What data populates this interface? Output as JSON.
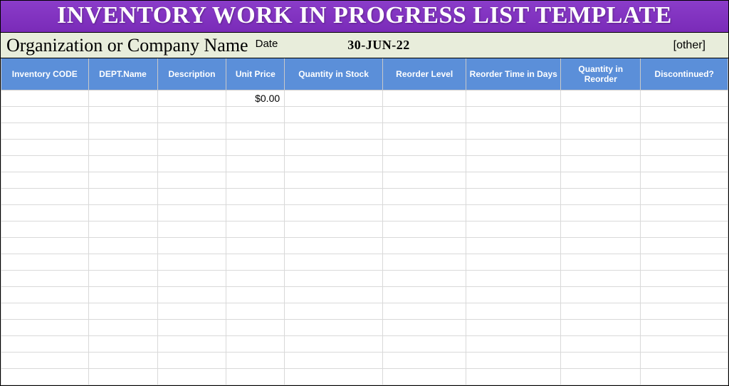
{
  "title": "INVENTORY WORK IN PROGRESS LIST TEMPLATE",
  "header": {
    "org_label": "Organization  or Company Name",
    "date_label": "Date",
    "date_value": "30-JUN-22",
    "other_label": "[other]"
  },
  "columns": [
    "Inventory CODE",
    "DEPT.Name",
    "Description",
    "Unit Price",
    "Quantity in Stock",
    "Reorder Level",
    "Reorder Time in Days",
    "Quantity in Reorder",
    "Discontinued?"
  ],
  "rows": [
    {
      "unit_price": "$0.00"
    },
    {},
    {},
    {},
    {},
    {},
    {},
    {},
    {},
    {},
    {},
    {},
    {},
    {},
    {},
    {},
    {},
    {}
  ]
}
